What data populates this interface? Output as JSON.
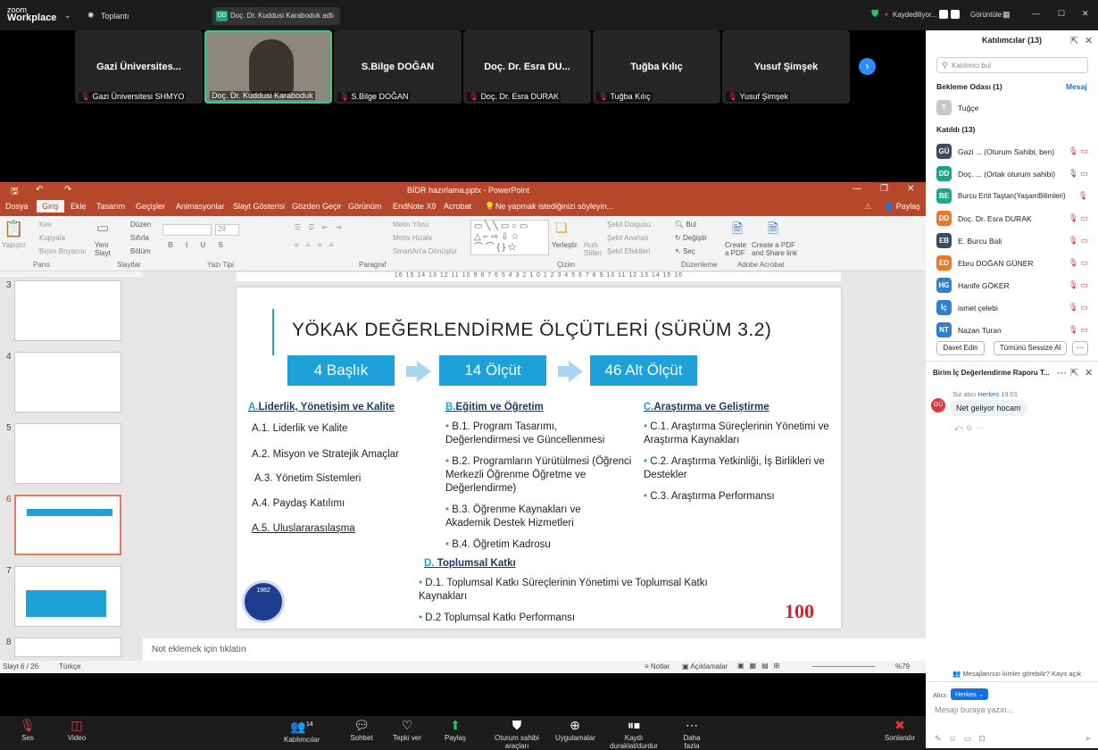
{
  "zoom": {
    "logo_line1": "zoom",
    "logo_line2": "Workplace",
    "meetings_label": "Toplantı",
    "speaker_chip": "Doç. Dr. Kuddusi Karaboduk adlı",
    "recording_status": "Kaydediliyor...",
    "view_label": "Görüntüle"
  },
  "gallery": {
    "tiles": [
      {
        "name": "Gazi Üniversites...",
        "label": "Gazi Üniversitesi SHMYO"
      },
      {
        "name": "",
        "label": "Doç. Dr. Kuddusi Karaboduk"
      },
      {
        "name": "S.Bilge DOĞAN",
        "label": "S.Bilge DOĞAN"
      },
      {
        "name": "Doç. Dr. Esra DU...",
        "label": "Doç. Dr. Esra DURAK"
      },
      {
        "name": "Tuğba Kılıç",
        "label": "Tuğba Kılıç"
      },
      {
        "name": "Yusuf Şimşek",
        "label": "Yusuf Şimşek"
      }
    ]
  },
  "ppt": {
    "title": "BİDR hazırlama.pptx - PowerPoint",
    "tabs": [
      "Dosya",
      "Giriş",
      "Ekle",
      "Tasarım",
      "Geçişler",
      "Animasyonlar",
      "Slayt Gösterisi",
      "Gözden Geçir",
      "Görünüm",
      "EndNote X9",
      "Acrobat"
    ],
    "tell_me": "Ne yapmak istediğinizi söyleyin...",
    "share": "Paylaş",
    "ribbon": {
      "paste": "Yapıştır",
      "cut": "Kes",
      "copy": "Kopyala",
      "format_painter": "Biçim Boyacısı",
      "group_clipboard": "Pano",
      "new_slide": "Yeni Slayt",
      "layout": "Düzen",
      "reset": "Sıfırla",
      "section": "Bölüm",
      "group_slides": "Slaytlar",
      "font_size": "29",
      "group_font": "Yazı Tipi",
      "text_direction": "Metin Yönü",
      "align_text": "Metni Hizala",
      "smartart": "SmartArt'a Dönüştür",
      "group_paragraph": "Paragraf",
      "arrange": "Yerleştir",
      "quick_styles": "Hızlı Stiller",
      "shape_fill": "Şekil Dolgusu",
      "shape_outline": "Şekil Anahatı",
      "shape_effects": "Şekil Efektleri",
      "group_drawing": "Çizim",
      "find": "Bul",
      "replace": "Değiştir",
      "select": "Seç",
      "group_editing": "Düzenleme",
      "create_pdf": "Create a PDF",
      "create_pdf_share": "Create a PDF and Share link",
      "group_acrobat": "Adobe Acrobat"
    },
    "thumbs": [
      "3",
      "4",
      "5",
      "6",
      "7",
      "8"
    ],
    "ruler": "16 15 14 13 12 11 10 9 8 7 6 5 4 3 2 1 0 1 2 3 4 5 6 7 8 9 10 11 12 13 14 15 16",
    "notes_placeholder": "Not eklemek için tıklatın",
    "status": {
      "slide": "Slayt 6 / 26",
      "language": "Türkçe",
      "notes": "Notlar",
      "comments": "Açıklamalar",
      "zoom": "%79"
    }
  },
  "slide": {
    "title": "YÖKAK DEĞERLENDİRME ÖLÇÜTLERİ (SÜRÜM 3.2)",
    "box1": "4 Başlık",
    "box2": "14 Ölçüt",
    "box3": "46 Alt Ölçüt",
    "colA_letter": "A.",
    "colA_head": "Liderlik, Yönetişim ve Kalite",
    "colA": [
      "A.1. Liderlik ve Kalite",
      "A.2. Misyon ve Stratejik Amaçlar",
      "A.3. Yönetim Sistemleri",
      "A.4. Paydaş Katılımı",
      "A.5. Uluslararasılaşma"
    ],
    "colB_letter": "B.",
    "colB_head": "Eğitim ve Öğretim",
    "colB": [
      "B.1. Program Tasarımı, Değerlendirmesi ve Güncellenmesi",
      "B.2. Programların Yürütülmesi (Öğrenci Merkezli Öğrenme Öğretme ve Değerlendirme)",
      "B.3. Öğrenme Kaynakları ve Akademik Destek Hizmetleri",
      "B.4. Öğretim Kadrosu"
    ],
    "colC_letter": "C.",
    "colC_head": "Araştırma ve Geliştirme",
    "colC": [
      "C.1. Araştırma Süreçlerinin Yönetimi ve Araştırma Kaynakları",
      "C.2. Araştırma Yetkinliği, İş Birlikleri ve Destekler",
      "C.3. Araştırma Performansı"
    ],
    "colD_letter": "D.",
    "colD_head": "Toplumsal Katkı",
    "colD": [
      "D.1. Toplumsal Katkı Süreçlerinin Yönetimi ve Toplumsal Katkı Kaynakları",
      "D.2 Toplumsal Katkı Performansı"
    ],
    "logo_year": "1982",
    "centenary": "100"
  },
  "participants": {
    "title": "Katılımcılar (13)",
    "search_placeholder": "Katılımcı bul",
    "waiting_room": "Bekleme Odası (1)",
    "message": "Mesaj",
    "waiting": [
      {
        "initials": "T",
        "name": "Tuğçe",
        "color": "#c8c8c8"
      }
    ],
    "joined_label": "Katıldı (13)",
    "joined": [
      {
        "initials": "GÜ",
        "name": "Gazi ...  (Oturum Sahibi, ben)",
        "color": "#3d4c5e"
      },
      {
        "initials": "DD",
        "name": "Doç. ...  (Ortak oturum sahibi)",
        "color": "#18a58a"
      },
      {
        "initials": "BE",
        "name": "Burcu Ertit Taştan(YaşamBilimleri)",
        "color": "#1aa88e"
      },
      {
        "initials": "DD",
        "name": "Doç. Dr. Esra DURAK",
        "color": "#e8792b"
      },
      {
        "initials": "EB",
        "name": "E. Burcu Bali",
        "color": "#3b4a5c"
      },
      {
        "initials": "ED",
        "name": "Ebru DOĞAN GÜNER",
        "color": "#e8792b"
      },
      {
        "initials": "HG",
        "name": "Hanife GÖKER",
        "color": "#2f7fd3"
      },
      {
        "initials": "İç",
        "name": "ismet çelebi",
        "color": "#2f7fd3"
      },
      {
        "initials": "NT",
        "name": "Nazan Turan",
        "color": "#2f7fd3"
      }
    ],
    "invite": "Davet Edin",
    "mute_all": "Tümünü Sessize Al"
  },
  "chat": {
    "title": "Birim İç Değerlendirme Raporu T...",
    "from": "Siz alıcı",
    "to": "Herkes",
    "time": "19:01",
    "avatar": "GÜ",
    "message": "Net geliyor hocam",
    "visibility": "Mesajlarınızı kimler görebilir? Kayıt açık",
    "recipient_label": "Alıcı:",
    "recipient": "Herkes",
    "input_placeholder": "Mesajı buraya yazın..."
  },
  "bottombar": {
    "audio": "Ses",
    "video": "Video",
    "participants": "Katılımcılar",
    "participants_count": "14",
    "chat": "Sohbet",
    "react": "Tepki ver",
    "share": "Paylaş",
    "host_tools": "Oturum sahibi araçları",
    "apps": "Uygulamalar",
    "record": "Kaydı duraklat/durdur",
    "more": "Daha fazla",
    "end": "Sonlandır"
  }
}
